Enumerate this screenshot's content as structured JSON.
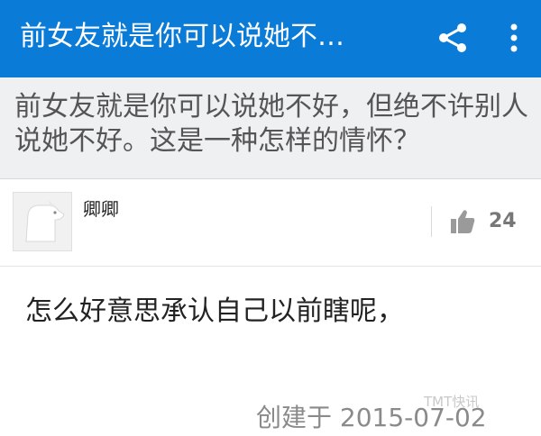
{
  "app_bar": {
    "title": "前女友就是你可以说她不…",
    "share_icon": "share-icon",
    "more_icon": "more-vertical-icon",
    "color": "#0a7bd6"
  },
  "question": {
    "text": "前女友就是你可以说她不好，但绝不许别人说她不好。这是一种怎样的情怀？"
  },
  "answer": {
    "author": "卿卿",
    "avatar_icon": "dog-avatar-icon",
    "like_icon": "thumbs-up-icon",
    "like_count": "24",
    "body": "怎么好意思承认自己以前瞎呢，",
    "created": "创建于 2015-07-02"
  },
  "watermark": {
    "text": "TMT快讯"
  }
}
